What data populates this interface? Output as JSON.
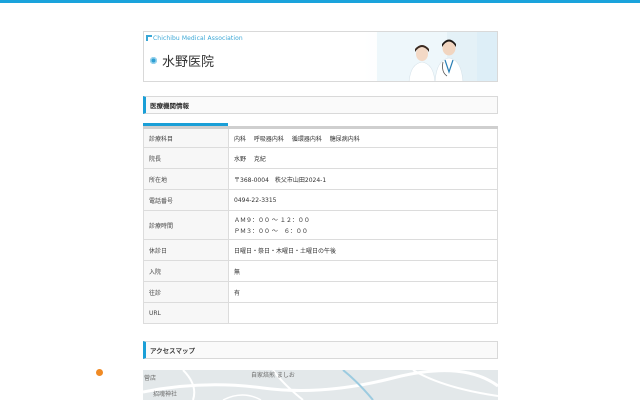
{
  "header": {
    "association": "Chichibu Medical Association",
    "title": "水野医院"
  },
  "sections": {
    "info_title": "医療機関情報",
    "map_title": "アクセスマップ"
  },
  "info": {
    "rows": [
      {
        "label": "診療科目",
        "value": "内科　 呼吸器内科　 循環器内科　 糖尿病内科"
      },
      {
        "label": "院長",
        "value": "水野　 克紀"
      },
      {
        "label": "所在地",
        "value": "〒368-0004　秩父市山田2024-1"
      },
      {
        "label": "電話番号",
        "value": "0494-22-3315"
      },
      {
        "label": "診療時間",
        "value": "ＡＭ９：００ ～ １２：００",
        "value2": "ＰＭ３：００ ～　６：００"
      },
      {
        "label": "休診日",
        "value": "日曜日・祭日・木曜日・土曜日の午後"
      },
      {
        "label": "入院",
        "value": "無"
      },
      {
        "label": "往診",
        "value": "有"
      },
      {
        "label": "URL",
        "value": ""
      }
    ]
  },
  "map": {
    "labels": [
      "菅店",
      "自家焙煎 ましお",
      "招魂神社"
    ]
  },
  "colors": {
    "accent": "#1aa3dc",
    "pin": "#f08a24"
  }
}
